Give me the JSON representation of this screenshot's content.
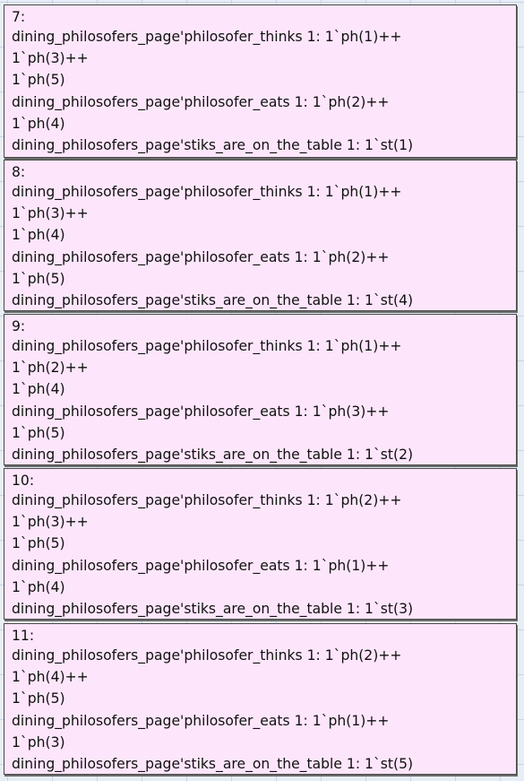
{
  "states": [
    {
      "id": "7:",
      "lines": [
        "dining_philosofers_page'philosofer_thinks 1: 1`ph(1)++",
        "1`ph(3)++",
        "1`ph(5)",
        "dining_philosofers_page'philosofer_eats 1: 1`ph(2)++",
        "1`ph(4)",
        "dining_philosofers_page'stiks_are_on_the_table 1: 1`st(1)"
      ]
    },
    {
      "id": "8:",
      "lines": [
        "dining_philosofers_page'philosofer_thinks 1: 1`ph(1)++",
        "1`ph(3)++",
        "1`ph(4)",
        "dining_philosofers_page'philosofer_eats 1: 1`ph(2)++",
        "1`ph(5)",
        "dining_philosofers_page'stiks_are_on_the_table 1: 1`st(4)"
      ]
    },
    {
      "id": "9:",
      "lines": [
        "dining_philosofers_page'philosofer_thinks 1: 1`ph(1)++",
        "1`ph(2)++",
        "1`ph(4)",
        "dining_philosofers_page'philosofer_eats 1: 1`ph(3)++",
        "1`ph(5)",
        "dining_philosofers_page'stiks_are_on_the_table 1: 1`st(2)"
      ]
    },
    {
      "id": "10:",
      "lines": [
        "dining_philosofers_page'philosofer_thinks 1: 1`ph(2)++",
        "1`ph(3)++",
        "1`ph(5)",
        "dining_philosofers_page'philosofer_eats 1: 1`ph(1)++",
        "1`ph(4)",
        "dining_philosofers_page'stiks_are_on_the_table 1: 1`st(3)"
      ]
    },
    {
      "id": "11:",
      "lines": [
        "dining_philosofers_page'philosofer_thinks 1: 1`ph(2)++",
        "1`ph(4)++",
        "1`ph(5)",
        "dining_philosofers_page'philosofer_eats 1: 1`ph(1)++",
        "1`ph(3)",
        "dining_philosofers_page'stiks_are_on_the_table 1: 1`st(5)"
      ]
    }
  ]
}
